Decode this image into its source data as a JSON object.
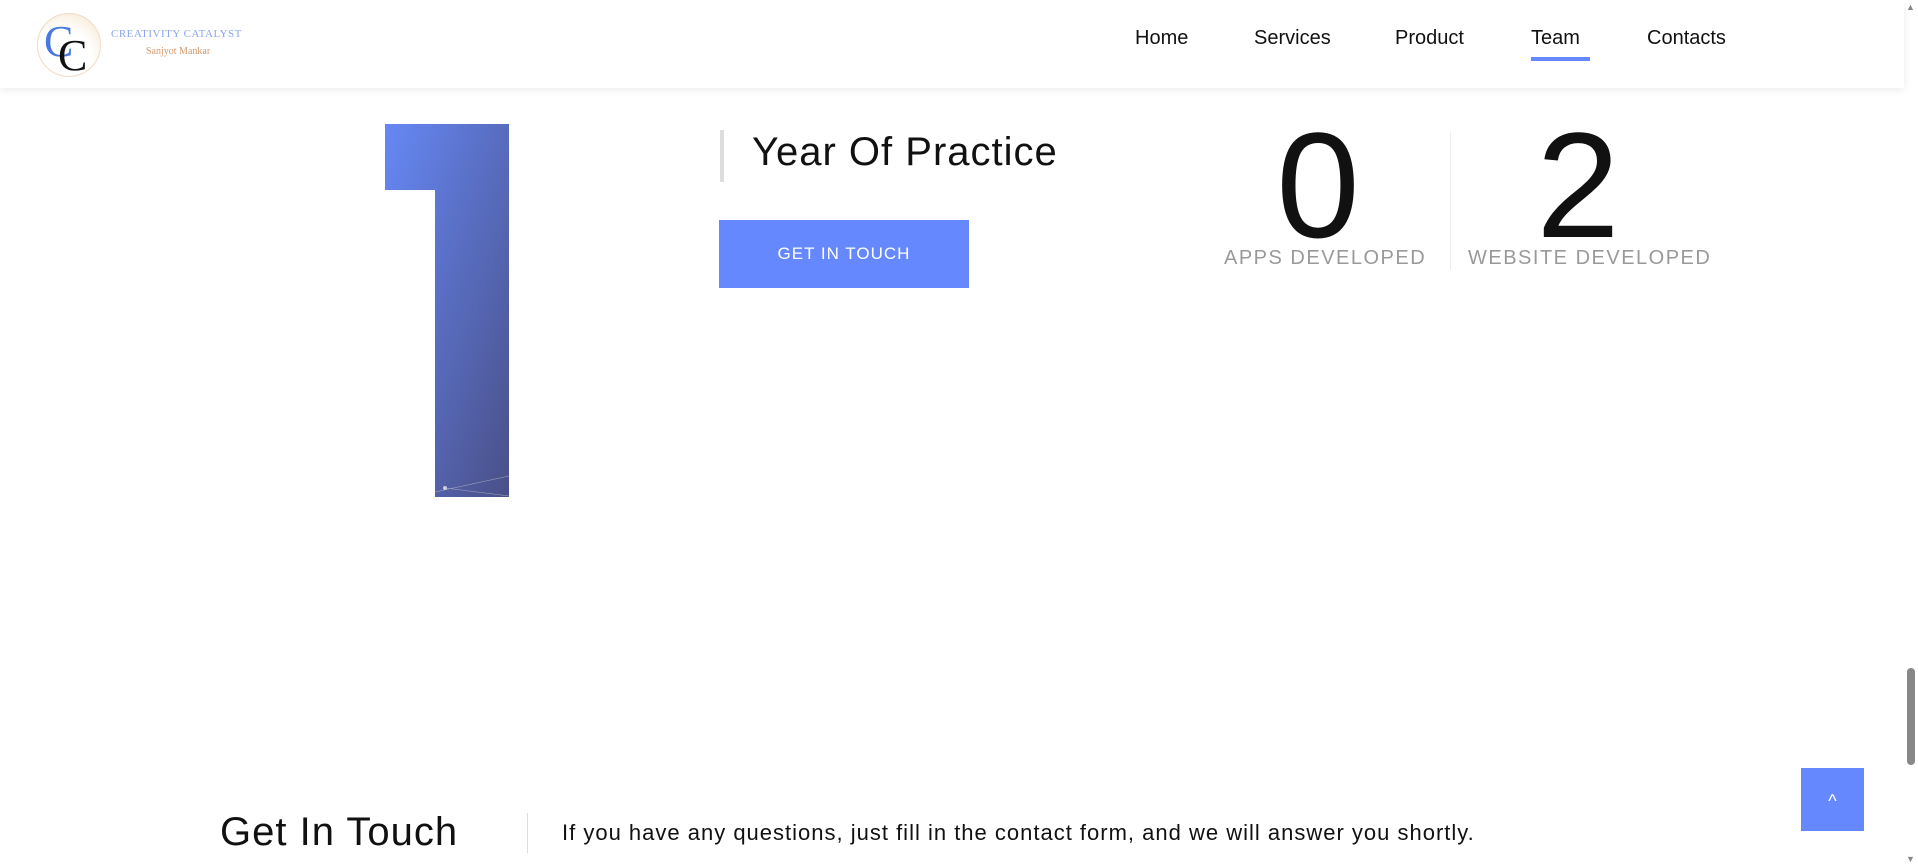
{
  "header": {
    "logo_letters": "CC",
    "brand_name": "CREATIVITY CATALYST",
    "brand_owner": "Sanjyot Mankar",
    "nav": [
      {
        "label": "Home"
      },
      {
        "label": "Services"
      },
      {
        "label": "Product"
      },
      {
        "label": "Team",
        "active": true
      },
      {
        "label": "Contacts"
      }
    ]
  },
  "stats": {
    "years_number": "1",
    "years_label": "Year Of Practice",
    "cta_label": "GET IN TOUCH",
    "counters": [
      {
        "value": "0",
        "label": "APPS DEVELOPED"
      },
      {
        "value": "2",
        "label": "WEBSITE DEVELOPED"
      }
    ]
  },
  "contact": {
    "title": "Get In Touch",
    "description": "If you have any questions, just fill in the contact form, and we will answer you shortly."
  },
  "scroll_top": {
    "icon": "chevron-up-icon",
    "glyph": "^"
  },
  "colors": {
    "accent": "#6688ff",
    "gradient_start": "#6688f5",
    "gradient_end": "#4a5088"
  }
}
